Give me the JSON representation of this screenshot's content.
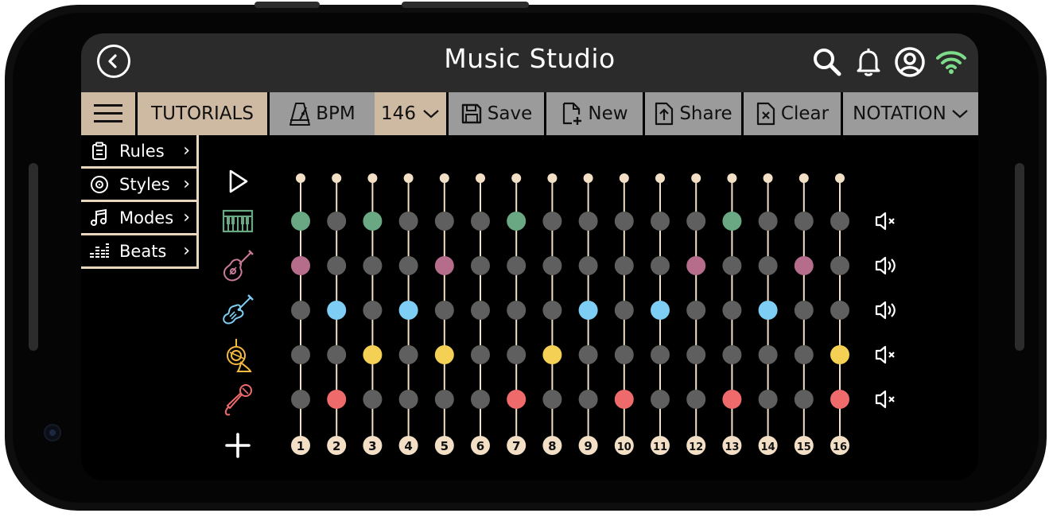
{
  "app": {
    "title": "Music Studio"
  },
  "icons": {
    "back": "back-arrow-circle-icon",
    "search": "search-icon",
    "bell": "bell-icon",
    "account": "account-circle-icon",
    "wifi": "wifi-icon",
    "menu": "hamburger-menu-icon",
    "metronome": "metronome-icon",
    "save": "floppy-disk-icon",
    "new": "new-file-icon",
    "share": "share-upload-icon",
    "clear": "clear-file-icon",
    "play": "play-icon",
    "add": "plus-icon"
  },
  "toolbar": {
    "tutorials": "TUTORIALS",
    "bpm_label": "BPM",
    "bpm_value": "146",
    "save": "Save",
    "new": "New",
    "share": "Share",
    "clear": "Clear",
    "notation": "NOTATION"
  },
  "menu": [
    {
      "label": "Rules",
      "icon": "clipboard-icon"
    },
    {
      "label": "Styles",
      "icon": "vinyl-record-icon"
    },
    {
      "label": "Modes",
      "icon": "music-note-icon"
    },
    {
      "label": "Beats",
      "icon": "equalizer-icon"
    }
  ],
  "colors": {
    "accent_beige": "#ceb9a2",
    "toolbar_grey": "#9b9b9b",
    "topbar": "#2b2b2b",
    "line": "#f2dfc6",
    "inactive_dot": "#5f5f5f",
    "wifi_green": "#7ddc8a"
  },
  "sequencer": {
    "steps": [
      "1",
      "2",
      "3",
      "4",
      "5",
      "6",
      "7",
      "8",
      "9",
      "10",
      "11",
      "12",
      "13",
      "14",
      "15",
      "16"
    ],
    "tracks": [
      {
        "instrument": "piano",
        "icon": "piano-icon",
        "color": "#6aa883",
        "muted": true,
        "active": [
          1,
          3,
          7,
          13
        ]
      },
      {
        "instrument": "acoustic guitar",
        "icon": "acoustic-guitar-icon",
        "color": "#b66d8c",
        "muted": false,
        "active": [
          1,
          5,
          12,
          15
        ]
      },
      {
        "instrument": "electric guitar",
        "icon": "electric-guitar-icon",
        "color": "#7dcdf4",
        "muted": false,
        "active": [
          2,
          4,
          9,
          11,
          14
        ]
      },
      {
        "instrument": "french horn",
        "icon": "french-horn-icon",
        "color": "#f4d055",
        "muted": true,
        "active": [
          3,
          5,
          8,
          16
        ]
      },
      {
        "instrument": "microphone",
        "icon": "microphone-icon",
        "color": "#ef6b6b",
        "muted": true,
        "active": [
          2,
          7,
          10,
          13,
          16
        ]
      }
    ]
  }
}
